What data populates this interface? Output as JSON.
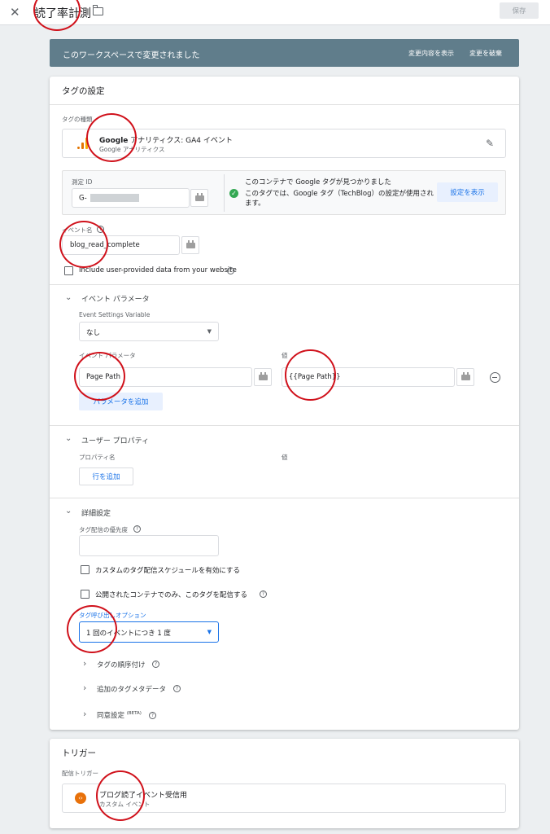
{
  "header": {
    "title": "読了率計測",
    "save_label": "保存"
  },
  "banner": {
    "message": "このワークスペースで変更されました",
    "show_changes": "変更内容を表示",
    "discard": "変更を破棄"
  },
  "tag_config": {
    "title": "タグの設定",
    "tag_type_label": "タグの種類",
    "tag_type_name_bold": "Google",
    "tag_type_name_rest": " アナリティクス: GA4 イベント",
    "tag_type_sub": "Google アナリティクス",
    "measurement_id_label": "測定 ID",
    "measurement_id_value": "G-",
    "notice_line1": "このコンテナで Google タグが見つかりました",
    "notice_line2": "このタグでは、Google タグ（TechBlog）の設定が使用されます。",
    "notice_button": "設定を表示",
    "event_name_label": "イベント名",
    "event_name_value": "blog_read_complete",
    "include_user_data": "Include user-provided data from your website"
  },
  "event_params": {
    "section": "イベント パラメータ",
    "settings_var_label": "Event Settings Variable",
    "settings_var_value": "なし",
    "param_col": "イベント パラメータ",
    "value_col": "値",
    "param_name": "Page Path",
    "param_value": "{{Page Path}}",
    "add_param": "パラメータを追加"
  },
  "user_props": {
    "section": "ユーザー プロパティ",
    "prop_col": "プロパティ名",
    "value_col": "値",
    "add_row": "行を追加"
  },
  "advanced": {
    "section": "詳細設定",
    "priority_label": "タグ配信の優先度",
    "schedule_checkbox": "カスタムのタグ配信スケジュールを有効にする",
    "published_only_checkbox": "公開されたコンテナでのみ、このタグを配信する",
    "firing_option_label": "タグ呼び出しオプション",
    "firing_option_value": "1 回のイベントにつき 1 度",
    "sequencing": "タグの順序付け",
    "metadata": "追加のタグメタデータ",
    "consent": "同意設定",
    "consent_badge": "(BETA)"
  },
  "trigger": {
    "title": "トリガー",
    "firing_label": "配信トリガー",
    "name": "ブログ読了イベント受信用",
    "type": "カスタム イベント"
  },
  "icons": {
    "close": "close-icon",
    "folder": "folder-icon",
    "edit": "pencil-icon",
    "analytics": "analytics-bars-icon",
    "check": "check-circle-icon",
    "remove": "remove-circle-icon",
    "trigger": "code-icon"
  },
  "colors": {
    "banner": "#607d8b",
    "accent": "#1a73e8",
    "annotation": "#d0111b",
    "analytics_orange": "#f9ab00",
    "trigger_orange": "#e8710a",
    "success": "#34a853"
  }
}
